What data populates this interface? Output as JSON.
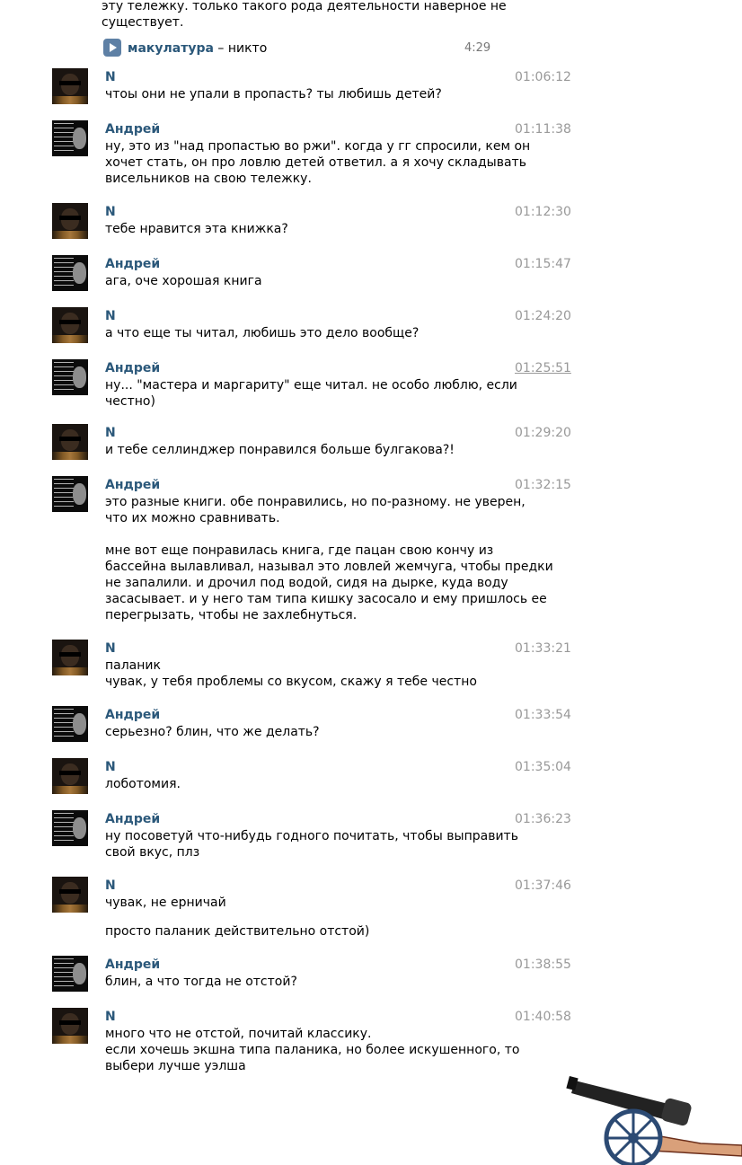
{
  "top": {
    "lines": [
      "эту тележку. только такого рода деятельности наверное не",
      "существует."
    ]
  },
  "audio": {
    "artist": "макулатура",
    "title": " – никто",
    "duration": "4:29"
  },
  "messages": [
    {
      "sender": "N",
      "time": "01:06:12",
      "lines": [
        "чтоы они не упали в пропасть? ты любишь детей?"
      ]
    },
    {
      "sender": "Андрей",
      "time": "01:11:38",
      "lines": [
        "ну, это из \"над пропастью во ржи\". когда у гг спросили, кем он",
        "хочет стать, он про ловлю детей ответил. а я хочу складывать",
        "висельников на свою тележку."
      ]
    },
    {
      "sender": "N",
      "time": "01:12:30",
      "lines": [
        "тебе нравится эта книжка?"
      ]
    },
    {
      "sender": "Андрей",
      "time": "01:15:47",
      "lines": [
        "ага, оче хорошая книга"
      ]
    },
    {
      "sender": "N",
      "time": "01:24:20",
      "lines": [
        "а что еще ты читал, любишь это дело вообще?"
      ]
    },
    {
      "sender": "Андрей",
      "time": "01:25:51",
      "lines": [
        "ну... \"мастера и маргариту\" еще читал. не особо люблю, если",
        "честно)"
      ]
    },
    {
      "sender": "N",
      "time": "01:29:20",
      "lines": [
        "и тебе селлинджер понравился больше булгакова?!"
      ]
    },
    {
      "sender": "Андрей",
      "time": "01:32:15",
      "lines": [
        "это разные книги. обе понравились, но по-разному. не уверен,",
        "что их можно сравнивать.",
        "",
        "мне вот еще понравилась книга, где пацан свою кончу из",
        "бассейна вылавливал, называл это ловлей жемчуга, чтобы предки",
        "не запалили. и дрочил под водой, сидя на дырке, куда воду",
        "засасывает. и у него там типа кишку засосало и ему пришлось ее",
        "перегрызать, чтобы не захлебнуться."
      ]
    },
    {
      "sender": "N",
      "time": "01:33:21",
      "lines": [
        "паланик",
        "чувак, у тебя проблемы со вкусом, скажу я тебе честно"
      ]
    },
    {
      "sender": "Андрей",
      "time": "01:33:54",
      "lines": [
        "серьезно? блин, что же делать?"
      ]
    },
    {
      "sender": "N",
      "time": "01:35:04",
      "lines": [
        "лоботомия."
      ]
    },
    {
      "sender": "Андрей",
      "time": "01:36:23",
      "lines": [
        "ну посоветуй что-нибудь годного почитать, чтобы выправить",
        "свой вкус, плз"
      ]
    },
    {
      "sender": "N",
      "time": "01:37:46",
      "lines": [
        "чувак, не ерничай",
        "",
        "просто паланик действительно отстой)"
      ]
    },
    {
      "sender": "Андрей",
      "time": "01:38:55",
      "lines": [
        "блин, а что тогда не отстой?"
      ]
    },
    {
      "sender": "N",
      "time": "01:40:58",
      "lines": [
        "много что не отстой, почитай классику.",
        "если хочешь экшна типа паланика, но более искушенного, то",
        "выбери лучше уэлша"
      ]
    }
  ],
  "colors": {
    "name": "#2b587a",
    "time": "#999999",
    "accent": "#5e80a5"
  },
  "icons": {
    "avatar_n": "avatar-dark-portrait",
    "avatar_andrey": "avatar-text-meme",
    "audio": "play-icon",
    "cannon": "cannon-icon"
  }
}
